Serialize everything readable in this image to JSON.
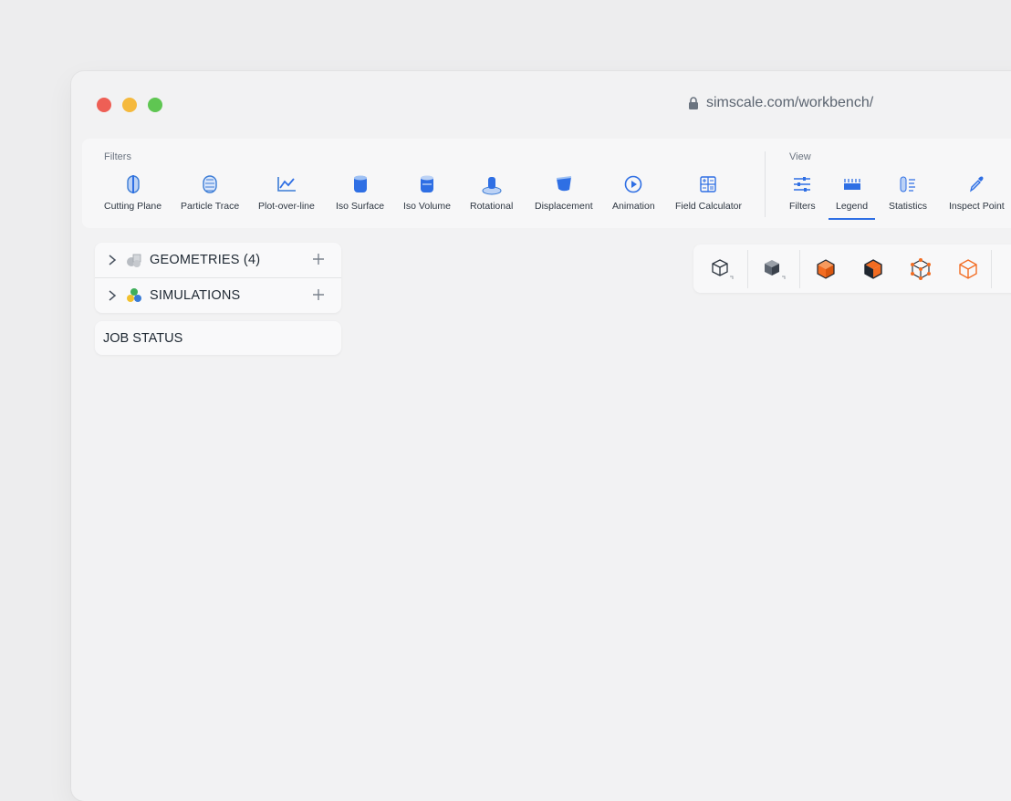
{
  "browser": {
    "url": "simscale.com/workbench/"
  },
  "toolbar": {
    "filters_group_label": "Filters",
    "view_group_label": "View",
    "filters_tools": [
      {
        "label": "Cutting Plane",
        "icon": "cutting-plane-icon"
      },
      {
        "label": "Particle Trace",
        "icon": "particle-trace-icon"
      },
      {
        "label": "Plot-over-line",
        "icon": "plot-over-line-icon"
      },
      {
        "label": "Iso Surface",
        "icon": "iso-surface-icon"
      },
      {
        "label": "Iso Volume",
        "icon": "iso-volume-icon"
      },
      {
        "label": "Rotational",
        "icon": "rotational-icon"
      },
      {
        "label": "Displacement",
        "icon": "displacement-icon"
      },
      {
        "label": "Animation",
        "icon": "animation-icon"
      },
      {
        "label": "Field Calculator",
        "icon": "field-calculator-icon"
      }
    ],
    "view_tools": [
      {
        "label": "Filters",
        "icon": "sliders-icon"
      },
      {
        "label": "Legend",
        "icon": "legend-icon",
        "active": true
      },
      {
        "label": "Statistics",
        "icon": "statistics-icon"
      },
      {
        "label": "Inspect Point",
        "icon": "eyedropper-icon"
      }
    ]
  },
  "tree": {
    "items": [
      {
        "label": "GEOMETRIES",
        "count": "(4)",
        "icon": "geometries-icon"
      },
      {
        "label": "SIMULATIONS",
        "icon": "simulations-icon"
      }
    ]
  },
  "job_status": {
    "label": "JOB STATUS"
  },
  "view_controls": {
    "buttons": [
      "cube-outline-icon",
      "cube-solid-icon",
      "cube-orange-faces-icon",
      "cube-orange-edges-icon",
      "cube-vertices-icon",
      "cube-wireframe-orange-icon"
    ]
  },
  "colors": {
    "accent": "#2f6fe4",
    "icon_blue": "#3a7bd5",
    "orange": "#f26c22",
    "traffic_red": "#ee5f55",
    "traffic_yellow": "#f5b93d",
    "traffic_green": "#5fc652"
  }
}
